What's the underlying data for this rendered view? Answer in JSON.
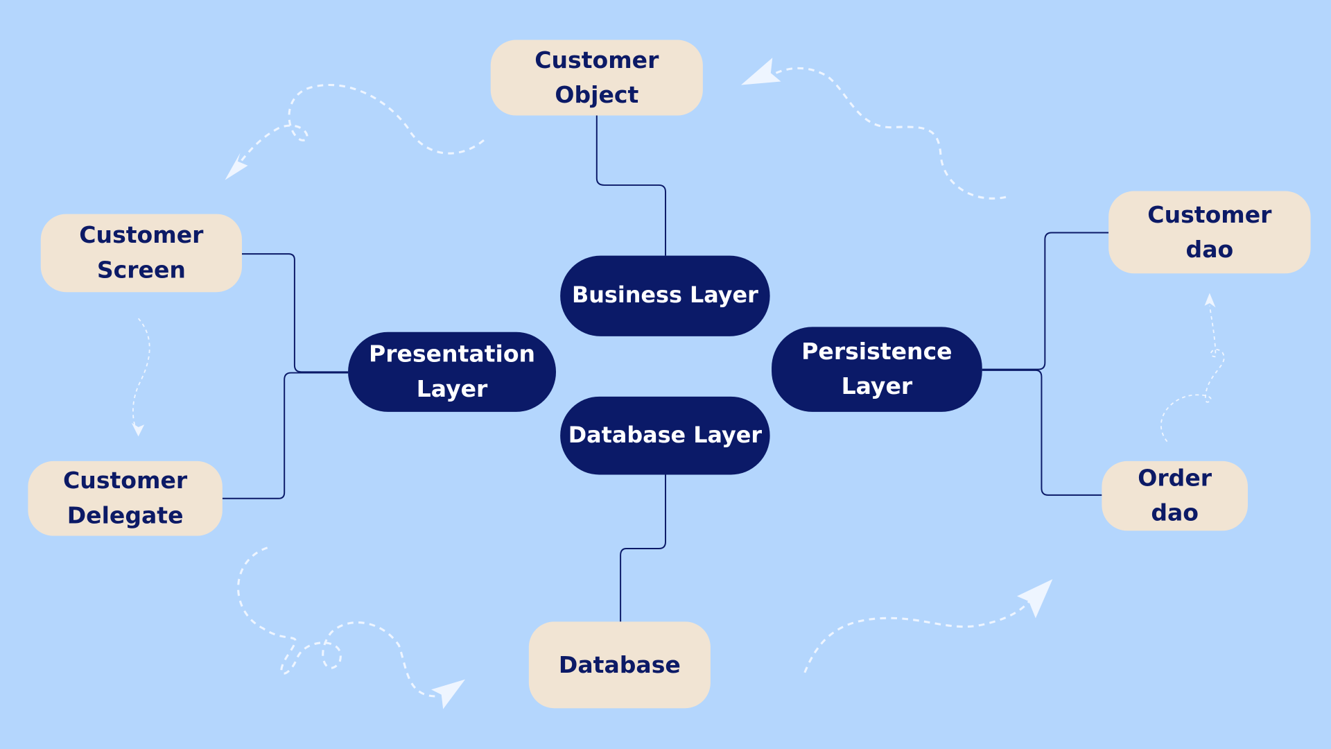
{
  "colors": {
    "background": "#b4d6fd",
    "layer_fill": "#0b1a68",
    "leaf_fill": "#f1e4d3",
    "text_dark": "#0c1a66",
    "connector": "#0b1a68",
    "decor": "#eef5ff"
  },
  "layers": {
    "business": "Business Layer",
    "presentation": "Presentation Layer",
    "database": "Database Layer",
    "persistence": "Persistence Layer"
  },
  "leaves": {
    "customer_object": "Customer Object",
    "customer_screen": "Customer Screen",
    "customer_delegate": "Customer Delegate",
    "database": "Database",
    "customer_dao": "Customer dao",
    "order_dao": "Order dao"
  }
}
